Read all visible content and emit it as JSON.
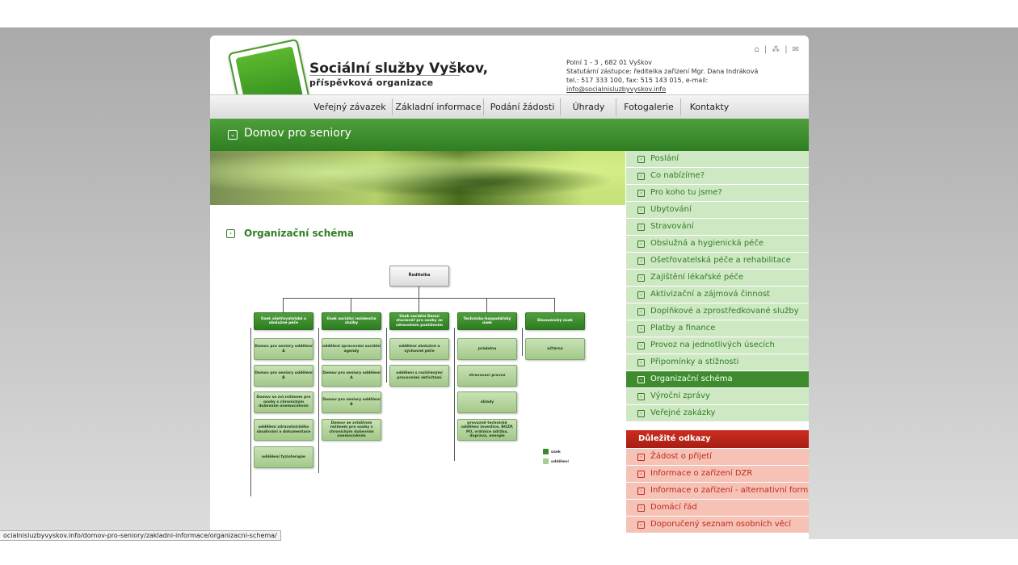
{
  "header": {
    "title": "Sociální služby Vyškov,",
    "subtitle": "příspěvková organizace",
    "reg_mark": "®",
    "contact_line1": "Polní 1 - 3 , 682 01 Vyškov",
    "contact_line2": "Statutární zástupce: ředitelka zařízení Mgr. Dana Indráková",
    "contact_line3": "tel.: 517 333 100, fax: 515 143 015, e-mail: ",
    "email": "info@socialnisluzbyvyskov.info",
    "utility_icons": [
      "home-icon",
      "sitemap-icon",
      "mail-icon"
    ]
  },
  "nav": [
    "Veřejný závazek",
    "Základní informace",
    "Podání žádosti",
    "Úhrady",
    "Fotogalerie",
    "Kontakty"
  ],
  "page_title": "Domov pro seniory",
  "section_title": "Organizační schéma",
  "org_chart": {
    "head": "Ředitelka",
    "departments": [
      {
        "name": "Úsek ošetřovatelské a obslužné péče",
        "units": [
          "Domov pro seniory oddělení A",
          "Domov pro seniory oddělení B",
          "Domov se zvl.režimem pro osoby s chronickým duševním onemocněním",
          "oddělení zdravotnického sbuďování a dokumentace",
          "oddělení fyzioterapie"
        ]
      },
      {
        "name": "Úsek sociální rezidenční služby",
        "units": [
          "oddělení zpracování sociální agendy",
          "Domov pro seniory oddělení A",
          "Domov pro seniory oddělení B",
          "Domov se zvláštním režimem pro osoby s chronickým duševním onemocněním"
        ]
      },
      {
        "name": "Úsek sociální Denní stacionář pro osoby se zdravotním postižením",
        "units": [
          "oddělení obslužné a výchovné péče",
          "oddělení s rozšířenými pracovními aktivitami"
        ]
      },
      {
        "name": "Technicko-hospodářský úsek",
        "units": [
          "prádelna",
          "stravovací provoz",
          "sklady",
          "provozně technické oddělení investice, BOZP, PO, vrátnice údržba, doprava, energie"
        ]
      },
      {
        "name": "Ekonomický úsek",
        "units": [
          "účtárna"
        ]
      }
    ],
    "legend": [
      {
        "label": "úsek",
        "color": "#3a8a2c"
      },
      {
        "label": "oddělení",
        "color": "#a8cd90"
      }
    ]
  },
  "sidebar": [
    "Poslání",
    "Co nabízíme?",
    "Pro koho tu jsme?",
    "Ubytování",
    "Stravování",
    "Obslužná a hygienická péče",
    "Ošetřovatelská péče a rehabilitace",
    "Zajištění lékařské péče",
    "Aktivizační a zájmová činnost",
    "Doplňkové a zprostředkované služby",
    "Platby a finance",
    "Provoz na jednotlivých úsecích",
    "Připomínky a stížnosti",
    "Organizační schéma",
    "Výroční zprávy",
    "Veřejné zakázky"
  ],
  "sidebar_active": "Organizační schéma",
  "important_links": {
    "title": "Důležité odkazy",
    "items": [
      "Žádost o přijetí",
      "Informace o zařízení DZR",
      "Informace o zařízení - alternativní forma",
      "Domácí řád",
      "Doporučený seznam osobních věcí"
    ]
  },
  "status_url": "ocialnisluzbyvyskov.info/domov-pro-seniory/zakladni-informace/organizacni-schema/"
}
